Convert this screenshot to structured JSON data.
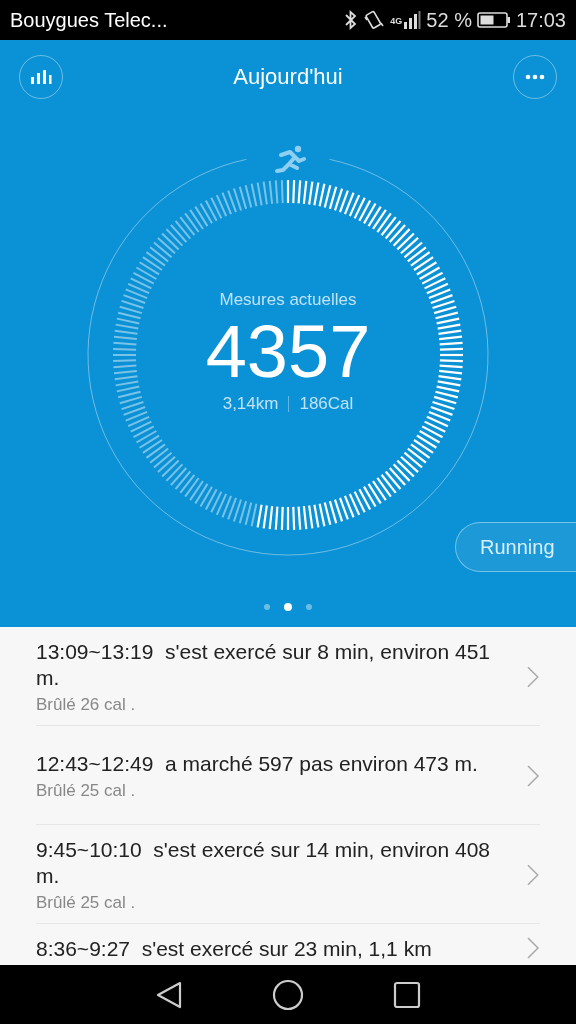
{
  "status_bar": {
    "carrier": "Bouygues Telec...",
    "network": "4G",
    "battery": "52 %",
    "time": "17:03"
  },
  "header": {
    "title": "Aujourd'hui"
  },
  "summary": {
    "label": "Mesures actuelles",
    "steps": "4357",
    "distance": "3,14km",
    "calories": "186Cal"
  },
  "mode_button": "Running",
  "pages": [
    {
      "selected": false
    },
    {
      "selected": true
    },
    {
      "selected": false
    }
  ],
  "activities": [
    {
      "title": "13:09~13:19  s'est exercé sur 8 min, environ 451 m.",
      "burned": "Brûlé 26 cal ."
    },
    {
      "title": "12:43~12:49  a marché 597 pas environ 473 m.",
      "burned": "Brûlé 25 cal ."
    },
    {
      "title": "9:45~10:10  s'est exercé sur 14 min, environ 408 m.",
      "burned": "Brûlé 25 cal ."
    },
    {
      "title": "8:36~9:27  s'est exercé sur 23 min, 1,1 km"
    }
  ]
}
